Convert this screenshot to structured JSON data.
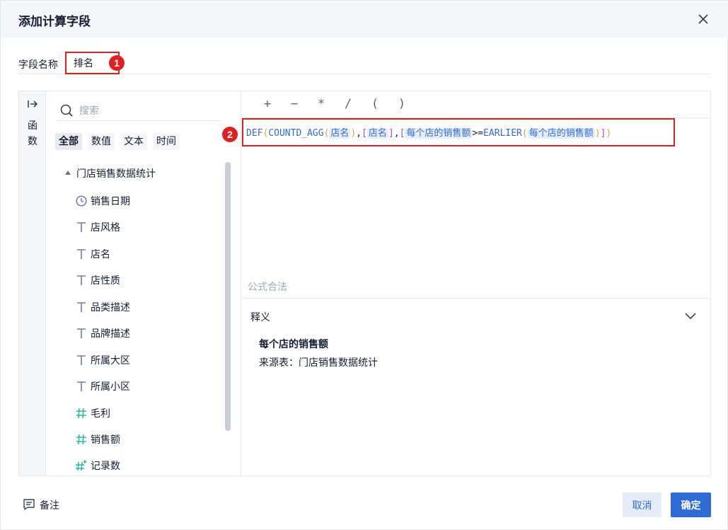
{
  "dialog": {
    "title": "添加计算字段"
  },
  "name_field": {
    "label": "字段名称",
    "value": "排名",
    "marker": "1"
  },
  "func_rail": {
    "label_1": "函",
    "label_2": "数"
  },
  "field_panel": {
    "search_placeholder": "搜索",
    "tabs": [
      "全部",
      "数值",
      "文本",
      "时间"
    ],
    "active_tab": "全部",
    "group": "门店销售数据统计",
    "fields": [
      {
        "label": "销售日期",
        "type": "date"
      },
      {
        "label": "店风格",
        "type": "text"
      },
      {
        "label": "店名",
        "type": "text"
      },
      {
        "label": "店性质",
        "type": "text"
      },
      {
        "label": "品类描述",
        "type": "text"
      },
      {
        "label": "品牌描述",
        "type": "text"
      },
      {
        "label": "所属大区",
        "type": "text"
      },
      {
        "label": "所属小区",
        "type": "text"
      },
      {
        "label": "毛利",
        "type": "number"
      },
      {
        "label": "销售额",
        "type": "number"
      },
      {
        "label": "记录数",
        "type": "calc-number"
      }
    ]
  },
  "editor": {
    "operators": [
      "+",
      "−",
      "*",
      "/",
      "(",
      ")"
    ],
    "marker": "2",
    "formula": {
      "fn_def": "DEF",
      "open1": "(",
      "fn_countd": "COUNTD_AGG",
      "open2": "(",
      "field_1": "店名",
      "close2": ")",
      "comma1": ",",
      "br_open1": "[",
      "field_2": "店名",
      "br_close1": "]",
      "comma2": ",",
      "br_open2": "[",
      "field_3": "每个店的销售额",
      "op_ge": ">=",
      "fn_earlier": "EARLIER",
      "open3": "(",
      "field_4": "每个店的销售额",
      "close3": ")",
      "br_close2": "]",
      "close1": ")"
    },
    "status": "公式合法",
    "explain": {
      "title": "释义",
      "name": "每个店的销售额",
      "source": "来源表：门店销售数据统计"
    }
  },
  "footer": {
    "note_label": "备注",
    "cancel_label": "取消",
    "ok_label": "确定"
  },
  "colors": {
    "accent": "#2f6bd4",
    "highlight_red": "#e02020",
    "number_icon": "#2fb3a0",
    "text_icon": "#6b7ea8"
  }
}
